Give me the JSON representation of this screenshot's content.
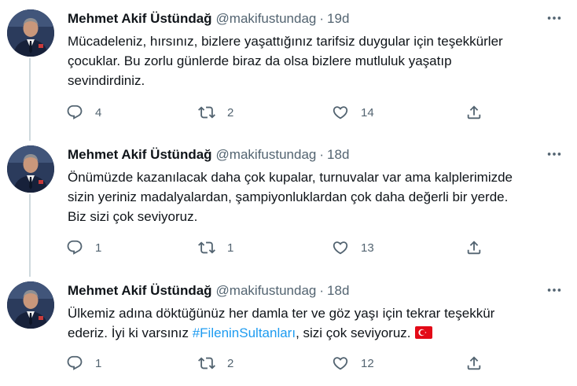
{
  "tweets": [
    {
      "author": {
        "name": "Mehmet Akif Üstündağ",
        "handle": "@makifustundag"
      },
      "time": "19d",
      "lines": [
        "Mücadeleniz, hırsınız, bizlere yaşattığınız tarifsiz duygular için teşekkürler",
        "çocuklar. Bu zorlu günlerde biraz da olsa bizlere mutluluk yaşatıp",
        "sevindirdiniz."
      ],
      "replies": "4",
      "retweets": "2",
      "likes": "14"
    },
    {
      "author": {
        "name": "Mehmet Akif Üstündağ",
        "handle": "@makifustundag"
      },
      "time": "18d",
      "lines": [
        "Önümüzde kazanılacak daha çok kupalar, turnuvalar var ama kalplerimizde",
        "sizin yeriniz madalyalardan, şampiyonluklardan çok daha değerli bir yerde.",
        "Biz sizi çok seviyoruz."
      ],
      "replies": "1",
      "retweets": "1",
      "likes": "13"
    },
    {
      "author": {
        "name": "Mehmet Akif Üstündağ",
        "handle": "@makifustundag"
      },
      "time": "18d",
      "lines": [
        "Ülkemiz adına döktüğünüz her damla ter ve göz yaşı için tekrar teşekkür"
      ],
      "line2_before": "ederiz. İyi ki varsınız ",
      "hashtag": "#FileninSultanları",
      "line2_after": ", sizi çok seviyoruz.",
      "replies": "1",
      "retweets": "2",
      "likes": "12"
    }
  ],
  "icons": {
    "more": "more-icon",
    "reply": "reply-icon",
    "retweet": "retweet-icon",
    "like": "heart-icon",
    "share": "share-icon",
    "flag": "turkey-flag-icon"
  },
  "colors": {
    "text": "#0f1419",
    "secondary": "#536471",
    "link": "#1d9bf0",
    "thread_line": "#cfd9de",
    "flag_red": "#e30a17"
  }
}
